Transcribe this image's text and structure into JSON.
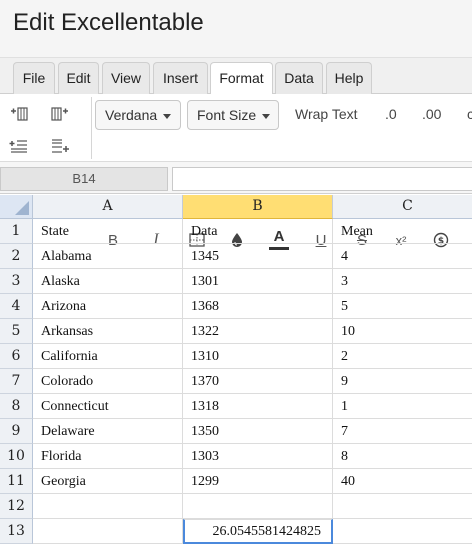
{
  "app": {
    "title": "Edit Excellentable"
  },
  "menu": {
    "tabs": [
      "File",
      "Edit",
      "View",
      "Insert",
      "Format",
      "Data",
      "Help"
    ],
    "active": "Format"
  },
  "toolbar": {
    "font_family": "Verdana",
    "font_size": "Font Size",
    "wrap_text": "Wrap Text",
    "decimal_decrease": ".0",
    "decimal_increase": ".00",
    "bold": "B",
    "italic": "I",
    "underline": "U",
    "strike": "S",
    "superscript": "x²",
    "text_color_letter": "A"
  },
  "formula_bar": {
    "cell_ref": "B14",
    "value": ""
  },
  "sheet": {
    "columns": [
      "A",
      "B",
      "C"
    ],
    "selected_column": "B",
    "rows": [
      {
        "num": "1",
        "cells": [
          "State",
          "Data",
          "Mean"
        ]
      },
      {
        "num": "2",
        "cells": [
          "Alabama",
          "1345",
          "4"
        ]
      },
      {
        "num": "3",
        "cells": [
          "Alaska",
          "1301",
          "3"
        ]
      },
      {
        "num": "4",
        "cells": [
          "Arizona",
          "1368",
          "5"
        ]
      },
      {
        "num": "5",
        "cells": [
          "Arkansas",
          "1322",
          "10"
        ]
      },
      {
        "num": "6",
        "cells": [
          "California",
          "1310",
          "2"
        ]
      },
      {
        "num": "7",
        "cells": [
          "Colorado",
          "1370",
          "9"
        ]
      },
      {
        "num": "8",
        "cells": [
          "Connecticut",
          "1318",
          "1"
        ]
      },
      {
        "num": "9",
        "cells": [
          "Delaware",
          "1350",
          "7"
        ]
      },
      {
        "num": "10",
        "cells": [
          "Florida",
          "1303",
          "8"
        ]
      },
      {
        "num": "11",
        "cells": [
          "Georgia",
          "1299",
          "40"
        ]
      },
      {
        "num": "12",
        "cells": [
          "",
          "",
          ""
        ]
      },
      {
        "num": "13",
        "cells": [
          "",
          "26.0545581424825",
          ""
        ]
      }
    ]
  },
  "colors": {
    "selected_header": "#ffde73",
    "active_border": "#4b89dc",
    "text_color_bar": "#333333"
  }
}
